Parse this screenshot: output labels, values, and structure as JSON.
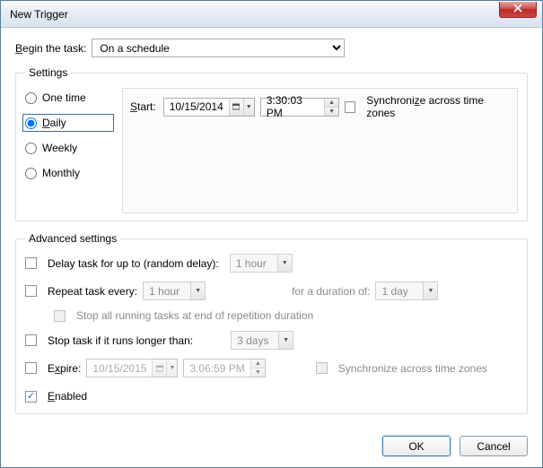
{
  "window": {
    "title": "New Trigger"
  },
  "begin": {
    "label": "Begin the task:",
    "value": "On a schedule"
  },
  "settings": {
    "legend": "Settings",
    "options": {
      "onetime": "One time",
      "daily": "Daily",
      "weekly": "Weekly",
      "monthly": "Monthly"
    },
    "selected": "daily",
    "start_label": "Start:",
    "start_date": "10/15/2014",
    "start_time": "3:30:03 PM",
    "sync_label": "Synchronize across time zones"
  },
  "advanced": {
    "legend": "Advanced settings",
    "delay_label": "Delay task for up to (random delay):",
    "delay_value": "1 hour",
    "repeat_label": "Repeat task every:",
    "repeat_value": "1 hour",
    "duration_label": "for a duration of:",
    "duration_value": "1 day",
    "stopall_label": "Stop all running tasks at end of repetition duration",
    "stoplong_label": "Stop task if it runs longer than:",
    "stoplong_value": "3 days",
    "expire_label": "Expire:",
    "expire_date": "10/15/2015",
    "expire_time": "3:06:59 PM",
    "sync2_label": "Synchronize across time zones",
    "enabled_label": "Enabled"
  },
  "footer": {
    "ok": "OK",
    "cancel": "Cancel"
  }
}
